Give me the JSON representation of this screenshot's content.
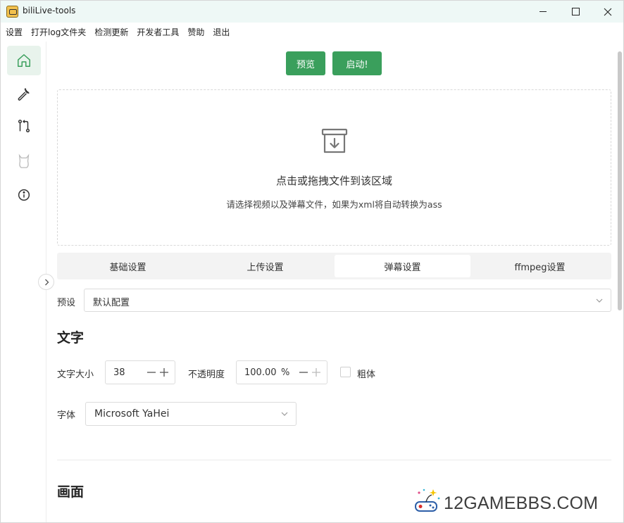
{
  "window": {
    "title": "biliLive-tools"
  },
  "menu": [
    "设置",
    "打开log文件夹",
    "检测更新",
    "开发者工具",
    "赞助",
    "退出"
  ],
  "sidebar": {
    "items": [
      {
        "icon": "home-icon",
        "active": true
      },
      {
        "icon": "wrench-icon",
        "active": false
      },
      {
        "icon": "git-compare-icon",
        "active": false
      },
      {
        "icon": "cat-icon",
        "active": false
      },
      {
        "icon": "info-icon",
        "active": false
      }
    ]
  },
  "actions": {
    "preview": "预览",
    "start": "启动!"
  },
  "dropzone": {
    "title": "点击或拖拽文件到该区域",
    "subtitle": "请选择视频以及弹幕文件，如果为xml将自动转换为ass"
  },
  "tabs": [
    {
      "label": "基础设置",
      "active": false
    },
    {
      "label": "上传设置",
      "active": false
    },
    {
      "label": "弹幕设置",
      "active": true
    },
    {
      "label": "ffmpeg设置",
      "active": false
    }
  ],
  "preset": {
    "label": "预设",
    "value": "默认配置"
  },
  "text_section": {
    "title": "文字",
    "font_size_label": "文字大小",
    "font_size_value": "38",
    "opacity_label": "不透明度",
    "opacity_value": "100.00",
    "opacity_unit": "%",
    "bold_label": "粗体",
    "bold_checked": false,
    "font_label": "字体",
    "font_value": "Microsoft YaHei"
  },
  "frame_section": {
    "title": "画面"
  },
  "watermark": {
    "text": "12GAMEBBS.COM"
  },
  "colors": {
    "accent": "#3a9f5c",
    "titlebar": "#eef8f6",
    "active_nav": "#e8f3ec"
  }
}
